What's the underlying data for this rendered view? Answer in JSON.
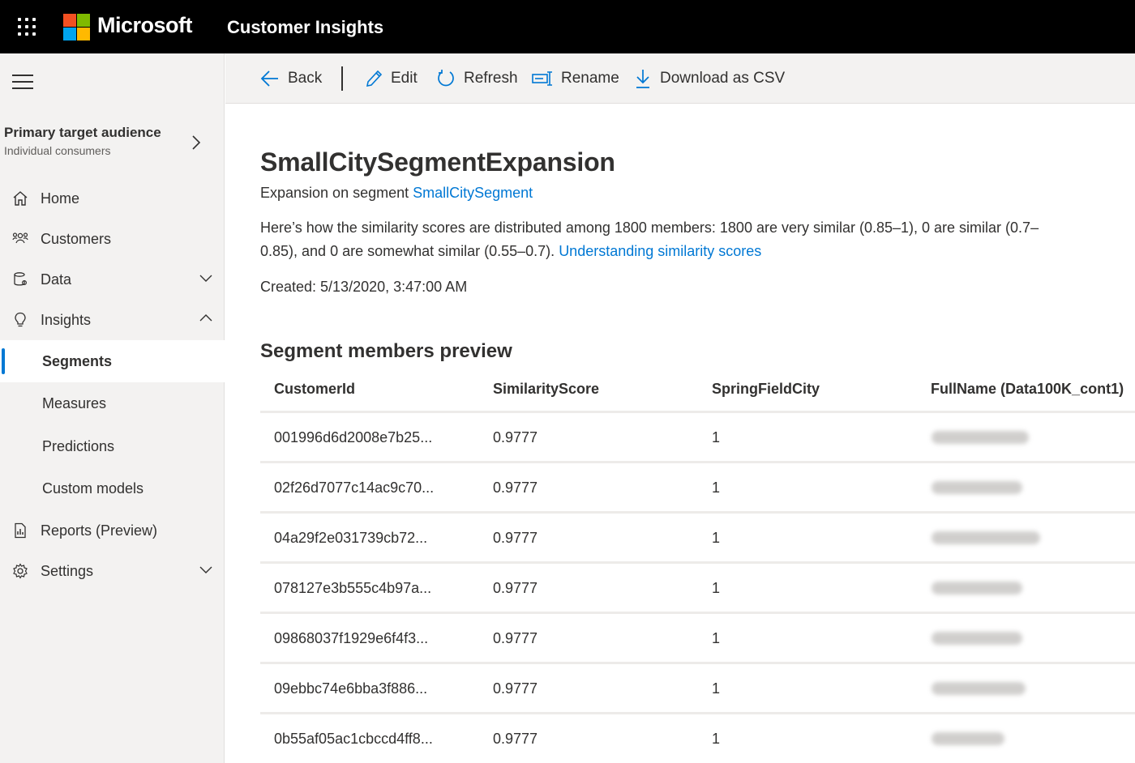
{
  "topbar": {
    "brand": "Microsoft",
    "app_title": "Customer Insights",
    "logo_colors": [
      "#f25022",
      "#7fba00",
      "#00a4ef",
      "#ffb900"
    ]
  },
  "sidebar": {
    "audience_title": "Primary target audience",
    "audience_subtitle": "Individual consumers",
    "items": [
      {
        "label": "Home",
        "icon": "home-icon"
      },
      {
        "label": "Customers",
        "icon": "people-icon"
      },
      {
        "label": "Data",
        "icon": "database-icon",
        "caret": "down"
      },
      {
        "label": "Insights",
        "icon": "lightbulb-icon",
        "caret": "up"
      },
      {
        "label": "Reports (Preview)",
        "icon": "report-icon"
      },
      {
        "label": "Settings",
        "icon": "gear-icon",
        "caret": "down"
      }
    ],
    "sub_items": [
      {
        "label": "Segments",
        "active": true
      },
      {
        "label": "Measures"
      },
      {
        "label": "Predictions"
      },
      {
        "label": "Custom models"
      }
    ]
  },
  "toolbar": {
    "back": "Back",
    "edit": "Edit",
    "refresh": "Refresh",
    "rename": "Rename",
    "download": "Download as CSV"
  },
  "page": {
    "title": "SmallCitySegmentExpansion",
    "expansion_prefix": "Expansion on segment ",
    "expansion_link": "SmallCitySegment",
    "description": "Here’s how the similarity scores are distributed among 1800 members: 1800 are very similar (0.85–1), 0 are similar (0.7–0.85), and 0 are somewhat similar (0.55–0.7). ",
    "description_link": "Understanding similarity scores",
    "created": "Created: 5/13/2020, 3:47:00 AM",
    "section_title": "Segment members preview"
  },
  "table": {
    "columns": [
      "CustomerId",
      "SimilarityScore",
      "SpringFieldCity",
      "FullName (Data100K_cont1)"
    ],
    "rows": [
      {
        "id": "001996d6d2008e7b25...",
        "score": "0.9777",
        "city": "1"
      },
      {
        "id": "02f26d7077c14ac9c70...",
        "score": "0.9777",
        "city": "1"
      },
      {
        "id": "04a29f2e031739cb72...",
        "score": "0.9777",
        "city": "1"
      },
      {
        "id": "078127e3b555c4b97a...",
        "score": "0.9777",
        "city": "1"
      },
      {
        "id": "09868037f1929e6f4f3...",
        "score": "0.9777",
        "city": "1"
      },
      {
        "id": "09ebbc74e6bba3f886...",
        "score": "0.9777",
        "city": "1"
      },
      {
        "id": "0b55af05ac1cbccd4ff8...",
        "score": "0.9777",
        "city": "1"
      }
    ]
  }
}
